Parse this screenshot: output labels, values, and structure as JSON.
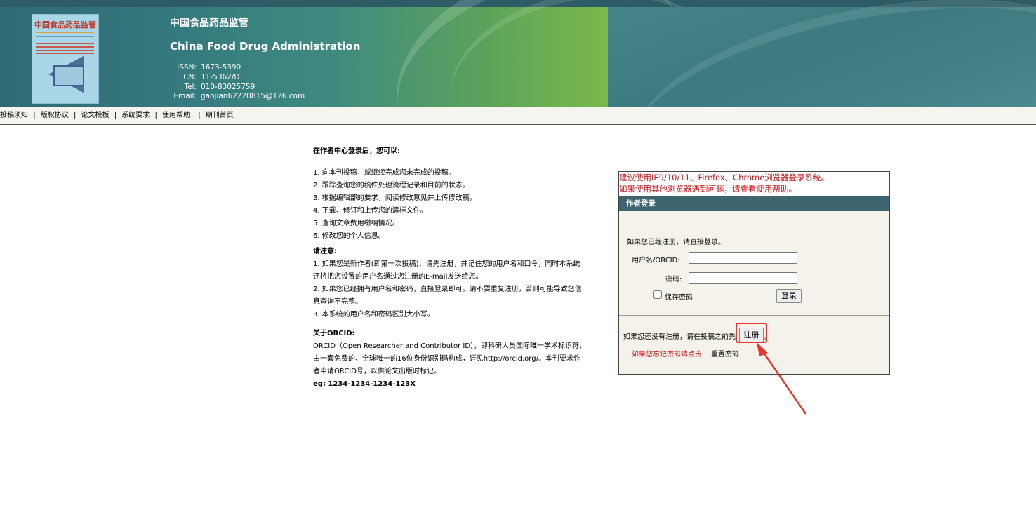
{
  "header": {
    "title_cn": "中国食品药品监管",
    "title_en": "China Food Drug Administration",
    "cover_title": "中国食品药品监管",
    "info": [
      {
        "key": "ISSN:",
        "value": "1673-5390"
      },
      {
        "key": "CN:",
        "value": "11-5362/D"
      },
      {
        "key": "Tel:",
        "value": "010-83025759"
      },
      {
        "key": "Email:",
        "value": "gaojian62220815@126.com"
      }
    ]
  },
  "nav": {
    "items": [
      "投稿须知",
      "版权协议",
      "论文模板",
      "系统要求",
      "使用帮助",
      "期刊首页"
    ],
    "separator": "|"
  },
  "info": {
    "intro_title": "在作者中心登录后，您可以:",
    "abilities": [
      "1. 向本刊投稿，或继续完成您未完成的投稿。",
      "2. 跟踪查询您的稿件处理流程记录和目前的状态。",
      "3. 根据编辑部的要求，阅读修改意见并上传修改稿。",
      "4. 下载、修订和上传您的清样文件。",
      "5. 查询文章费用缴纳情况。",
      "6. 修改您的个人信息。"
    ],
    "notice_title": "请注意:",
    "notices": [
      "1. 如果您是新作者(即第一次投稿)，请先注册，并记住您的用户名和口令，同时本系统还将把您设置的用户名通过您注册的E-mail发送给您。",
      "2. 如果您已经拥有用户名和密码，直接登录即可。请不要重复注册，否则可能导致您信息查询不完整。",
      "3. 本系统的用户名和密码区别大小写。"
    ],
    "orcid_title": "关于ORCID:",
    "orcid_text": "ORCID（Open Researcher and Contributor ID），即科研人员国际唯一学术标识符，由一套免费的、全球唯一的16位身份识别码构成，详见http://orcid.org/。本刊要求作者申请ORCID号，以供论文出版时标记。",
    "orcid_example": "eg: 1234-1234-1234-123X"
  },
  "login": {
    "warning_line1": "建议使用IE9/10/11、Firefox、Chrome浏览器登录系统。",
    "warning_line2": "如果使用其他浏览器遇到问题，请查看使用帮助。",
    "title": "作者登录",
    "registered_prompt": "如果您已经注册，请直接登录。",
    "username_label": "用户名/ORCID:",
    "username_value": "",
    "password_label": "密码:",
    "password_value": "",
    "remember_label": "保存密码",
    "remember_checked": false,
    "login_button": "登录",
    "not_registered_prompt": "如果您还没有注册，请在投稿之前先",
    "register_button": "注册",
    "register_suffix": "。",
    "forgot_text": "如果您忘记密码请点击",
    "reset_link": "重置密码"
  },
  "colors": {
    "banner_teal": "#3f7e86",
    "banner_green": "#7ab84a",
    "login_bar": "#3e6470",
    "warning_red": "#c8181c",
    "highlight_red": "#e8342c"
  }
}
